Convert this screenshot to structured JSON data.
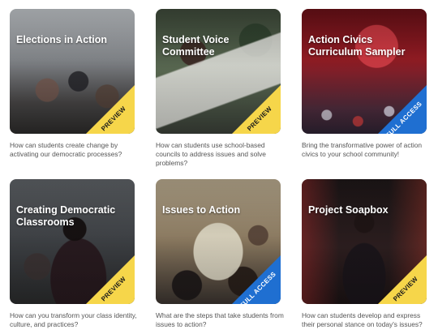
{
  "cards": [
    {
      "title": "Elections in Action",
      "ribbon": "PREVIEW",
      "description": "How can students create change by activating our democratic processes?"
    },
    {
      "title": "Student Voice Committee",
      "ribbon": "PREVIEW",
      "description": "How can students use school-based councils to address issues and solve problems?"
    },
    {
      "title": "Action Civics Curriculum Sampler",
      "ribbon": "FULL ACCESS",
      "description": "Bring the transformative power of action civics to your school community!"
    },
    {
      "title": "Creating Democratic Classrooms",
      "ribbon": "PREVIEW",
      "description": "How can you transform your class identity, culture, and practices?"
    },
    {
      "title": "Issues to Action",
      "ribbon": "FULL ACCESS",
      "description": "What are the steps that take students from issues to action?"
    },
    {
      "title": "Project Soapbox",
      "ribbon": "PREVIEW",
      "description": "How can students develop and express their personal stance on today's issues?"
    }
  ],
  "colors": {
    "preview_ribbon": "#f6d64a",
    "full_access_ribbon": "#1f6fd1",
    "description_text": "#555555"
  }
}
